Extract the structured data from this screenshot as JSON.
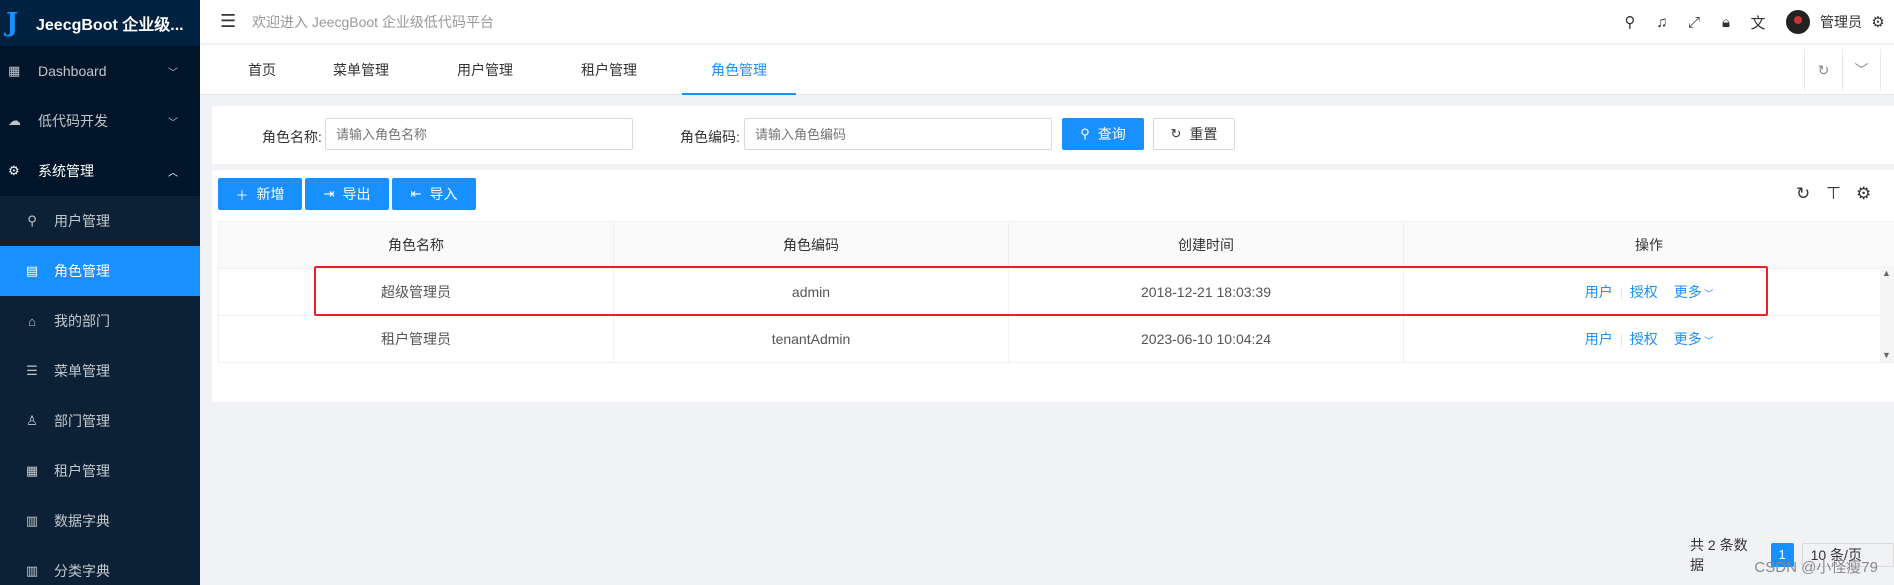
{
  "app": {
    "logo_text": "JeecgBoot 企业级..."
  },
  "sidebar": {
    "groups": [
      {
        "label": "Dashboard",
        "icon": "dashboard-icon"
      },
      {
        "label": "低代码开发",
        "icon": "cloud-icon"
      },
      {
        "label": "系统管理",
        "icon": "gear-icon"
      }
    ],
    "items": [
      {
        "label": "用户管理",
        "icon": "user-icon"
      },
      {
        "label": "角色管理",
        "icon": "file-icon"
      },
      {
        "label": "我的部门",
        "icon": "home-icon"
      },
      {
        "label": "菜单管理",
        "icon": "list-icon"
      },
      {
        "label": "部门管理",
        "icon": "team-icon"
      },
      {
        "label": "租户管理",
        "icon": "grid-icon"
      },
      {
        "label": "数据字典",
        "icon": "book-icon"
      },
      {
        "label": "分类字典",
        "icon": "book-icon"
      }
    ]
  },
  "header": {
    "welcome": "欢迎进入 JeecgBoot 企业级低代码平台",
    "username": "管理员"
  },
  "tabs": [
    {
      "label": "首页"
    },
    {
      "label": "菜单管理"
    },
    {
      "label": "用户管理"
    },
    {
      "label": "租户管理"
    },
    {
      "label": "角色管理"
    }
  ],
  "search": {
    "role_name_label": "角色名称:",
    "role_name_placeholder": "请输入角色名称",
    "role_code_label": "角色编码:",
    "role_code_placeholder": "请输入角色编码",
    "query_label": "查询",
    "reset_label": "重置"
  },
  "toolbar": {
    "add_label": "新增",
    "export_label": "导出",
    "import_label": "导入"
  },
  "table": {
    "columns": [
      "角色名称",
      "角色编码",
      "创建时间",
      "操作"
    ],
    "rows": [
      {
        "name": "超级管理员",
        "code": "admin",
        "created": "2018-12-21 18:03:39"
      },
      {
        "name": "租户管理员",
        "code": "tenantAdmin",
        "created": "2023-06-10 10:04:24"
      }
    ],
    "actions": {
      "users": "用户",
      "grant": "授权",
      "more": "更多"
    }
  },
  "pagination": {
    "total_text": "共 2 条数据",
    "current_page": "1",
    "page_size": "10 条/页"
  },
  "watermark": "CSDN @小怪瘦79",
  "colors": {
    "accent": "#1890ff",
    "sidebar_bg": "#001529",
    "highlight": "#e8222a"
  }
}
